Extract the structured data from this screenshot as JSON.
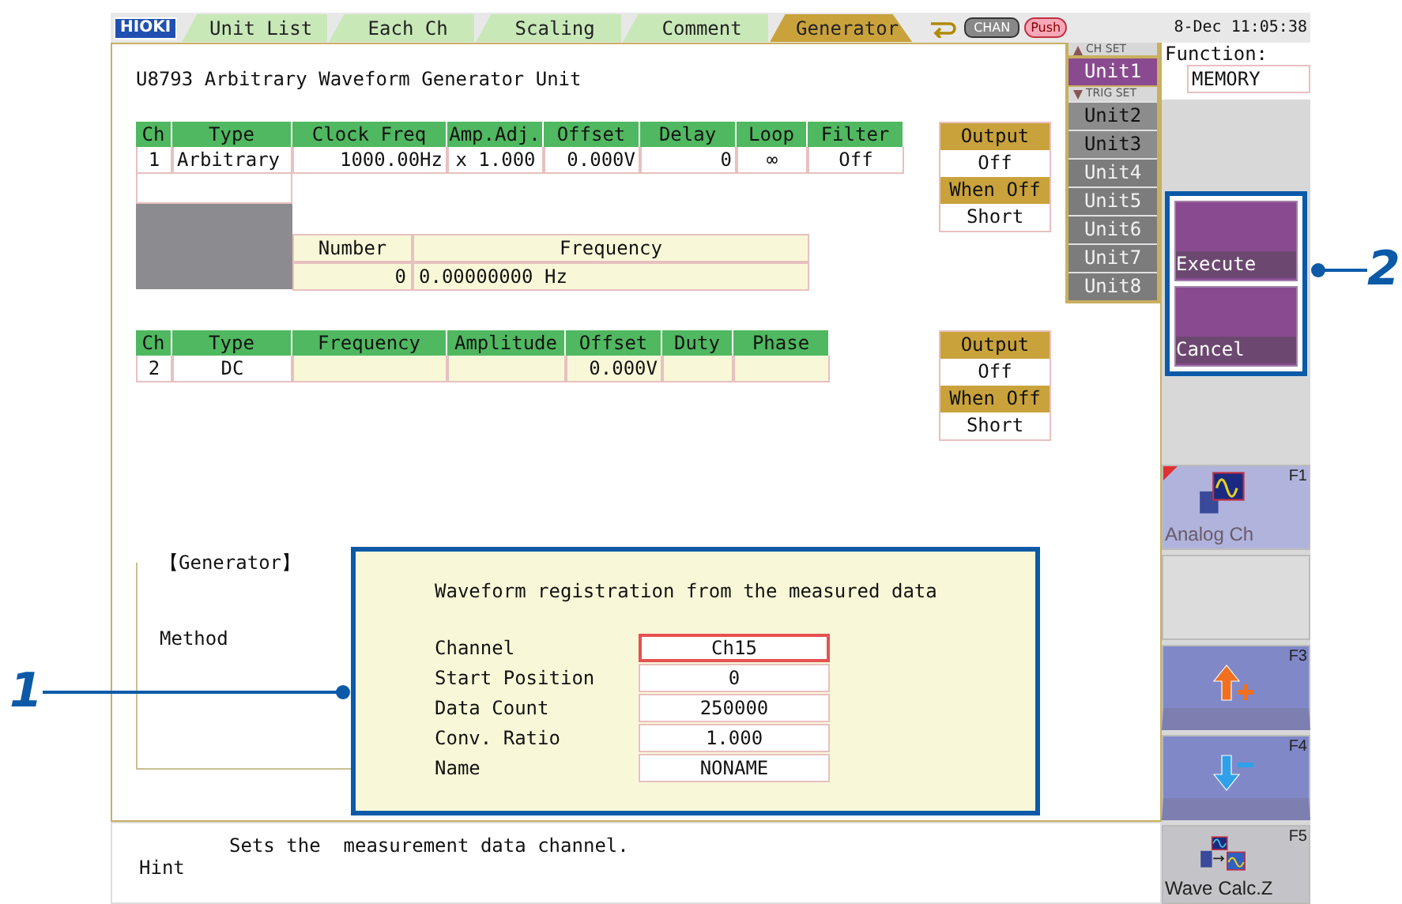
{
  "header": {
    "logo": "HIOKI",
    "tabs": [
      {
        "label": "Unit List",
        "selected": false
      },
      {
        "label": "Each Ch",
        "selected": false
      },
      {
        "label": "Scaling",
        "selected": false
      },
      {
        "label": "Comment",
        "selected": false
      },
      {
        "label": "Generator",
        "selected": true
      }
    ],
    "chan": "CHAN",
    "push": "Push",
    "time": "8-Dec 11:05:38"
  },
  "title": "U8793  Arbitrary Waveform Generator Unit",
  "units": {
    "ch_set": "CH SET",
    "trig_set": "TRIG SET",
    "items": [
      {
        "label": "Unit1",
        "selected": true,
        "disabled": false
      },
      {
        "label": "Unit2",
        "selected": false,
        "disabled": false
      },
      {
        "label": "Unit3",
        "selected": false,
        "disabled": false
      },
      {
        "label": "Unit4",
        "selected": false,
        "disabled": true
      },
      {
        "label": "Unit5",
        "selected": false,
        "disabled": true
      },
      {
        "label": "Unit6",
        "selected": false,
        "disabled": true
      },
      {
        "label": "Unit7",
        "selected": false,
        "disabled": true
      },
      {
        "label": "Unit8",
        "selected": false,
        "disabled": true
      }
    ]
  },
  "function": {
    "label": "Function:",
    "value": "MEMORY"
  },
  "arb_table": {
    "columns": [
      "Ch",
      "Type",
      "Clock Freq",
      "Amp.Adj.",
      "Offset",
      "Delay",
      "Loop",
      "Filter"
    ],
    "row": [
      "1",
      "Arbitrary",
      "1000.00Hz",
      "x 1.000",
      "0.000V",
      "0",
      "∞",
      "Off"
    ]
  },
  "freq_table": {
    "columns": [
      "Number",
      "Frequency"
    ],
    "row": [
      "0",
      "0.00000000 Hz"
    ]
  },
  "output1": {
    "output_label": "Output",
    "output": "Off",
    "when_off_label": "When Off",
    "when_off": "Short"
  },
  "dc_table": {
    "columns": [
      "Ch",
      "Type",
      "Frequency",
      "Amplitude",
      "Offset",
      "Duty",
      "Phase"
    ],
    "row": {
      "column_1": "2",
      "column_2": "DC",
      "column_5": "0.000V"
    }
  },
  "output2": {
    "output_label": "Output",
    "output": "Off",
    "when_off_label": "When Off",
    "when_off": "Short"
  },
  "generator": {
    "title": "【Generator】",
    "method": "Method"
  },
  "dialog": {
    "title": "Waveform registration from the measured data",
    "fields": [
      {
        "label": "Channel",
        "value": "Ch15",
        "selected": true
      },
      {
        "label": "Start Position",
        "value": "0",
        "selected": false
      },
      {
        "label": "Data Count",
        "value": "250000",
        "selected": false
      },
      {
        "label": "Conv. Ratio",
        "value": "1.000",
        "selected": false
      },
      {
        "label": "Name",
        "value": "NONAME",
        "selected": false
      }
    ]
  },
  "hint": {
    "text": "Sets the  measurement data channel.",
    "label": "Hint"
  },
  "actions": [
    {
      "label": "Execute"
    },
    {
      "label": "Cancel"
    }
  ],
  "fkeys": [
    {
      "kind": "analog",
      "key": "F1",
      "label": "Analog Ch"
    },
    {
      "kind": "blank"
    },
    {
      "kind": "up",
      "key": "F3"
    },
    {
      "kind": "down",
      "key": "F4"
    },
    {
      "kind": "calc",
      "key": "F5",
      "label": "Wave Calc.Z"
    }
  ],
  "callouts": [
    {
      "label": "1"
    },
    {
      "label": "2"
    }
  ]
}
